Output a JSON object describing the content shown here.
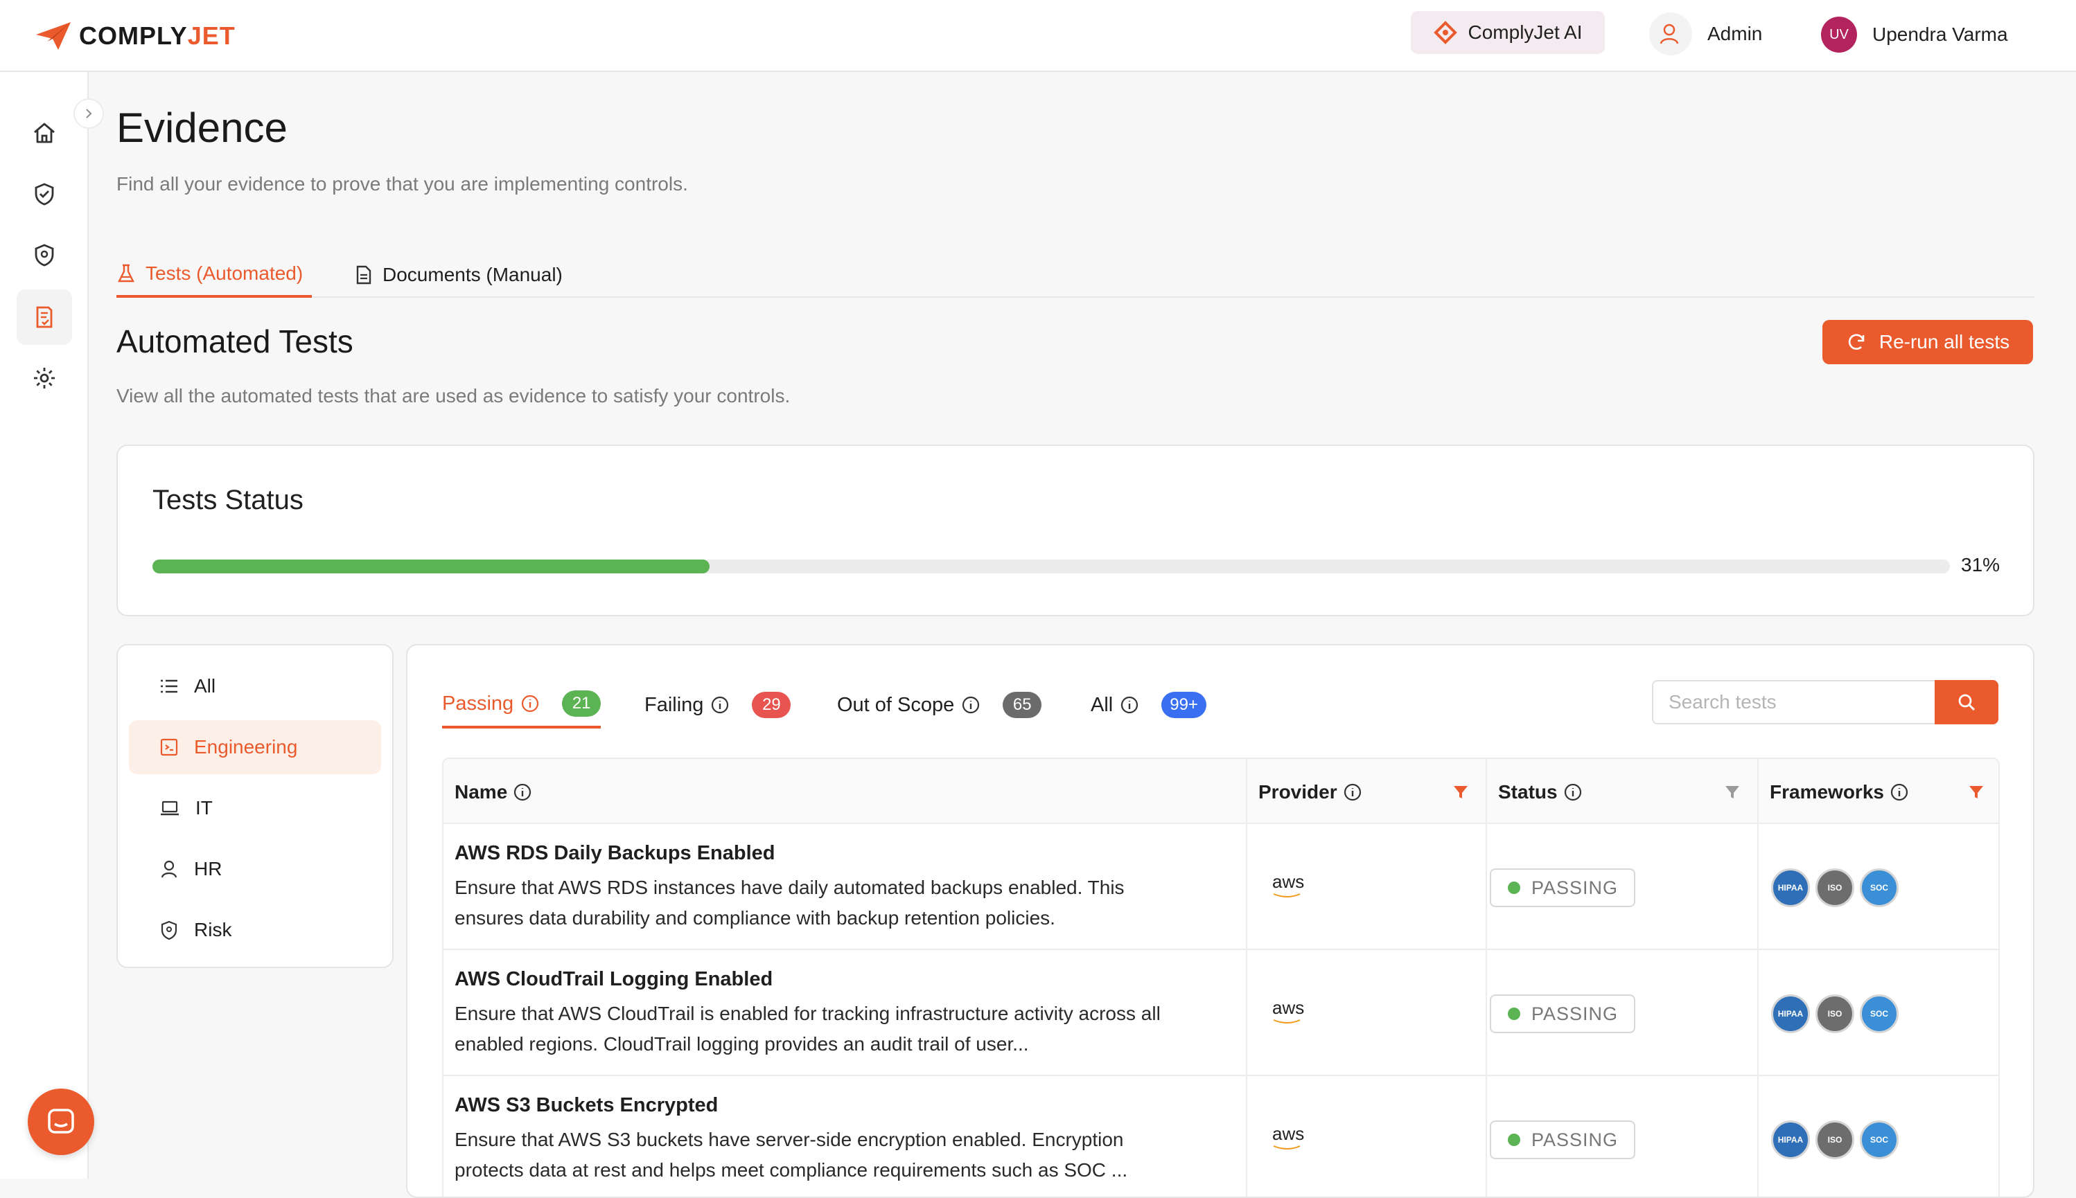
{
  "brand": {
    "name_a": "COMPLY",
    "name_b": "JET",
    "accent": "#ea5a2d"
  },
  "header": {
    "ai_label": "ComplyJet AI",
    "admin_label": "Admin",
    "user_initials": "UV",
    "user_name": "Upendra Varma"
  },
  "sidebar": {
    "items": [
      {
        "icon": "home-icon"
      },
      {
        "icon": "shield-check-icon"
      },
      {
        "icon": "shield-icon"
      },
      {
        "icon": "evidence-icon",
        "active": true
      },
      {
        "icon": "gear-icon"
      }
    ]
  },
  "page": {
    "title": "Evidence",
    "subtitle": "Find all your evidence to prove that you are implementing controls."
  },
  "tabs": [
    {
      "label": "Tests (Automated)",
      "active": true
    },
    {
      "label": "Documents (Manual)",
      "active": false
    }
  ],
  "section": {
    "title": "Automated Tests",
    "subtitle": "View all the automated tests that are used as evidence to satisfy your controls.",
    "rerun_label": "Re-run all tests"
  },
  "status": {
    "title": "Tests Status",
    "progress_percent": 31,
    "progress_label": "31%",
    "progress_color": "#5cb353"
  },
  "categories": [
    {
      "label": "All",
      "icon": "list-icon"
    },
    {
      "label": "Engineering",
      "icon": "code-icon",
      "active": true
    },
    {
      "label": "IT",
      "icon": "laptop-icon"
    },
    {
      "label": "HR",
      "icon": "person-icon"
    },
    {
      "label": "Risk",
      "icon": "shield-icon"
    }
  ],
  "filters": [
    {
      "label": "Passing",
      "count": "21",
      "color": "#5cb353",
      "active": true
    },
    {
      "label": "Failing",
      "count": "29",
      "color": "#e8544f"
    },
    {
      "label": "Out of Scope",
      "count": "65",
      "color": "#6b6b6b"
    },
    {
      "label": "All",
      "count": "99+",
      "color": "#3a6ff2"
    }
  ],
  "search": {
    "placeholder": "Search tests"
  },
  "table": {
    "columns": [
      "Name",
      "Provider",
      "Status",
      "Frameworks"
    ],
    "rows": [
      {
        "name": "AWS RDS Daily Backups Enabled",
        "description": "Ensure that AWS RDS instances have daily automated backups enabled. This ensures data durability and compliance with backup retention policies.",
        "provider": "aws",
        "status": "PASSING"
      },
      {
        "name": "AWS CloudTrail Logging Enabled",
        "description": "Ensure that AWS CloudTrail is enabled for tracking infrastructure activity across all enabled regions. CloudTrail logging provides an audit trail of user...",
        "provider": "aws",
        "status": "PASSING"
      },
      {
        "name": "AWS S3 Buckets Encrypted",
        "description": "Ensure that AWS S3 buckets have server-side encryption enabled. Encryption protects data at rest and helps meet compliance requirements such as SOC ...",
        "provider": "aws",
        "status": "PASSING"
      }
    ],
    "frameworks": [
      "HIPAA",
      "ISO",
      "SOC"
    ]
  }
}
